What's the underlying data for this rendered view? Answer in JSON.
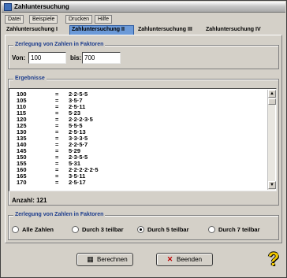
{
  "window": {
    "title": "Zahluntersuchung"
  },
  "menu": [
    "Datei",
    "Beispiele",
    "Drucken",
    "Hilfe"
  ],
  "tabs": [
    {
      "label": "Zahluntersuchung I",
      "active": false
    },
    {
      "label": "Zahluntersuchung II",
      "active": true
    },
    {
      "label": "Zahluntersuchung III",
      "active": false
    },
    {
      "label": "Zahluntersuchung IV",
      "active": false
    }
  ],
  "range_group": {
    "title": "Zerlegung von Zahlen in Faktoren",
    "from_label": "Von:",
    "from_value": "100",
    "to_label": "bis:",
    "to_value": "700"
  },
  "results": {
    "title": "Ergebnisse",
    "rows": [
      {
        "n": "100",
        "eq": "=",
        "f": "2·2·5·5"
      },
      {
        "n": "105",
        "eq": "=",
        "f": "3·5·7"
      },
      {
        "n": "110",
        "eq": "=",
        "f": "2·5·11"
      },
      {
        "n": "115",
        "eq": "=",
        "f": "5·23"
      },
      {
        "n": "120",
        "eq": "=",
        "f": "2·2·2·3·5"
      },
      {
        "n": "125",
        "eq": "=",
        "f": "5·5·5"
      },
      {
        "n": "130",
        "eq": "=",
        "f": "2·5·13"
      },
      {
        "n": "135",
        "eq": "=",
        "f": "3·3·3·5"
      },
      {
        "n": "140",
        "eq": "=",
        "f": "2·2·5·7"
      },
      {
        "n": "145",
        "eq": "=",
        "f": "5·29"
      },
      {
        "n": "150",
        "eq": "=",
        "f": "2·3·5·5"
      },
      {
        "n": "155",
        "eq": "=",
        "f": "5·31"
      },
      {
        "n": "160",
        "eq": "=",
        "f": "2·2·2·2·2·5"
      },
      {
        "n": "165",
        "eq": "=",
        "f": "3·5·11"
      },
      {
        "n": "170",
        "eq": "=",
        "f": "2·5·17"
      }
    ],
    "count_label": "Anzahl: 121"
  },
  "filter_group": {
    "title": "Zerlegung von Zahlen in Faktoren",
    "options": [
      {
        "label": "Alle Zahlen",
        "selected": false
      },
      {
        "label": "Durch 3 teilbar",
        "selected": false
      },
      {
        "label": "Durch 5 teilbar",
        "selected": true
      },
      {
        "label": "Durch 7 teilbar",
        "selected": false
      }
    ]
  },
  "buttons": {
    "calculate": {
      "label": "Berechnen",
      "icon": "calculator-icon"
    },
    "quit": {
      "label": "Beenden",
      "icon": "close-x-icon"
    }
  },
  "colors": {
    "accent": "#1c3c8c",
    "tab_active": "#6c9ad8",
    "help": "#f0c800"
  }
}
